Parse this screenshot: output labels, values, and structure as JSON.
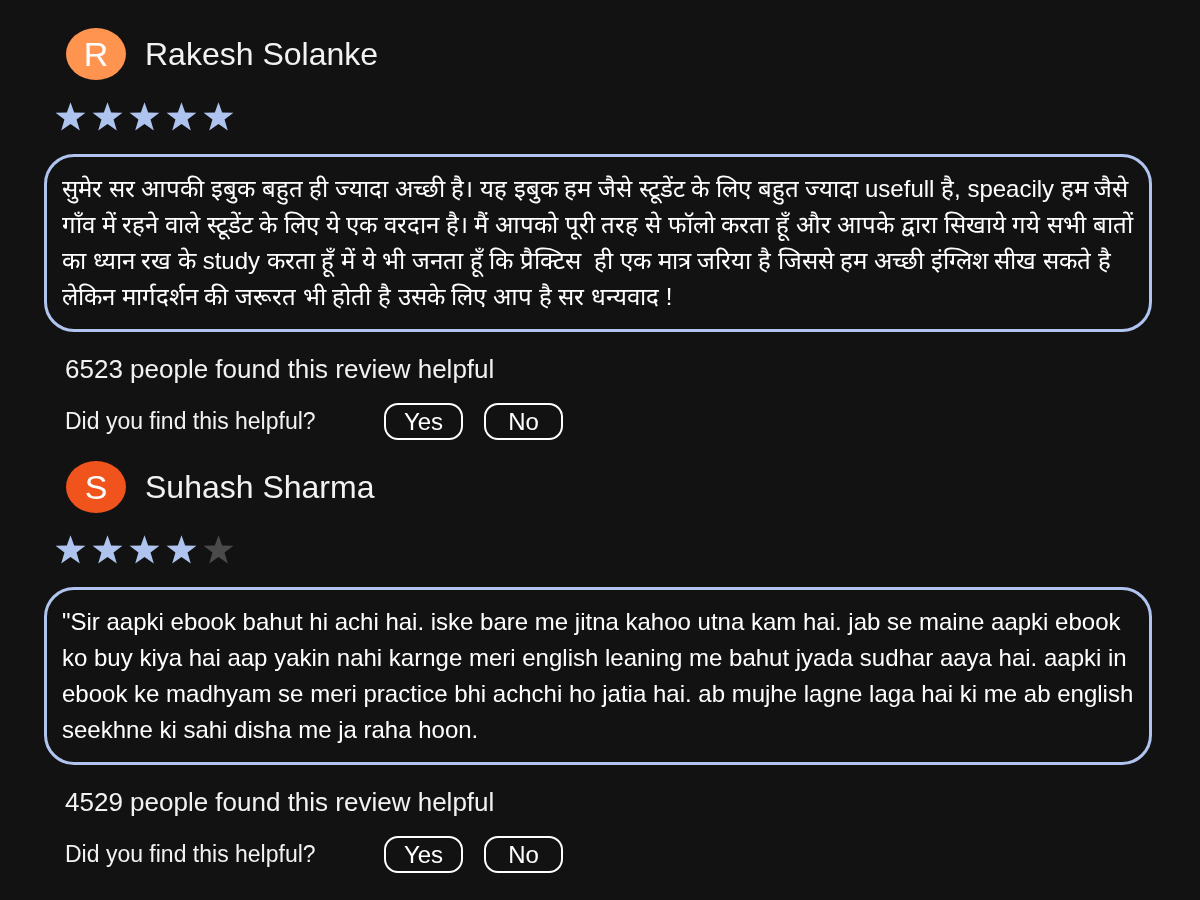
{
  "reviews": [
    {
      "avatar_letter": "R",
      "color": "#ff9350",
      "name": "Rakesh Solanke",
      "stars": 5,
      "text": "सुमेर सर आपकी इबुक बहुत ही ज्यादा अच्छी है। यह इबुक हम जैसे स्टूडेंट के लिए बहुत ज्यादा usefull है, speacily हम जैसे गाँव में रहने वाले स्टूडेंट के लिए ये एक वरदान है। मैं आपको पूरी तरह से फॉलो करता हूँ और आपके द्वारा सिखाये गये सभी बातों का ध्यान रख के study करता हूँ में ये भी जनता हूँ कि प्रैक्टिस  ही एक मात्र जरिया है जिससे हम अच्छी इंग्लिश सीख सकते है लेकिन मार्गदर्शन की जरूरत भी होती है उसके लिए आप है सर धन्यवाद !",
      "helpful_count": "6523 people found this review helpful",
      "helpful_prompt": "Did you find this helpful?",
      "buttons": [
        "Yes",
        "No"
      ]
    },
    {
      "avatar_letter": "S",
      "color": "#f0541c",
      "name": "Suhash Sharma",
      "stars": 4,
      "text": "\"Sir aapki ebook bahut hi achi hai. iske bare me jitna kahoo utna kam hai. jab se maine aapki ebook ko buy kiya hai aap yakin nahi karnge meri english leaning me bahut jyada sudhar aaya hai. aapki in ebook ke madhyam se meri practice bhi achchi ho jatia hai. ab mujhe lagne laga hai ki me ab english seekhne ki sahi disha me ja raha hoon.",
      "helpful_count": "4529 people found this review helpful",
      "helpful_prompt": "Did you find this helpful?",
      "buttons": [
        "Yes",
        "No"
      ]
    }
  ]
}
